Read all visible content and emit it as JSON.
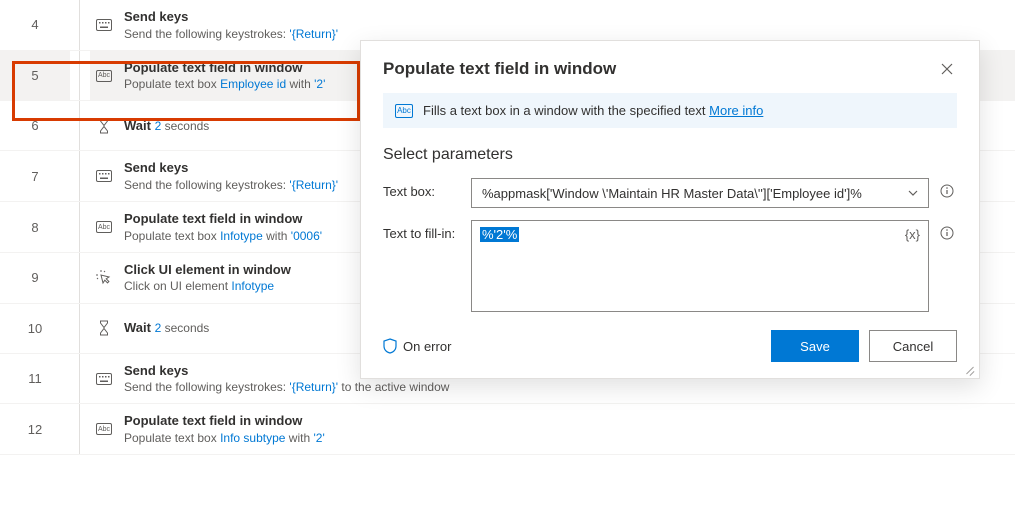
{
  "steps": [
    {
      "num": "4",
      "icon": "keyboard",
      "title": "Send keys",
      "desc_pre": "Send the following keystrokes: ",
      "tok1": "'{Return}'",
      "desc_mid": "",
      "tok2": "",
      "desc_post": ""
    },
    {
      "num": "5",
      "icon": "abc",
      "title": "Populate text field in window",
      "desc_pre": "Populate text box ",
      "tok1": "Employee id",
      "desc_mid": " with ",
      "tok2": "'2'",
      "desc_post": ""
    },
    {
      "num": "6",
      "icon": "hourglass",
      "title": "Wait",
      "desc_pre": "",
      "tok1": "2",
      "desc_mid": " seconds",
      "tok2": "",
      "desc_post": "",
      "inline": true
    },
    {
      "num": "7",
      "icon": "keyboard",
      "title": "Send keys",
      "desc_pre": "Send the following keystrokes: ",
      "tok1": "'{Return}'",
      "desc_mid": "",
      "tok2": "",
      "desc_post": ""
    },
    {
      "num": "8",
      "icon": "abc",
      "title": "Populate text field in window",
      "desc_pre": "Populate text box ",
      "tok1": "Infotype",
      "desc_mid": " with ",
      "tok2": "'0006'",
      "desc_post": ""
    },
    {
      "num": "9",
      "icon": "click",
      "title": "Click UI element in window",
      "desc_pre": "Click on UI element ",
      "tok1": "Infotype",
      "desc_mid": "",
      "tok2": "",
      "desc_post": ""
    },
    {
      "num": "10",
      "icon": "hourglass",
      "title": "Wait",
      "desc_pre": "",
      "tok1": "2",
      "desc_mid": " seconds",
      "tok2": "",
      "desc_post": "",
      "inline": true
    },
    {
      "num": "11",
      "icon": "keyboard",
      "title": "Send keys",
      "desc_pre": "Send the following keystrokes: ",
      "tok1": "'{Return}'",
      "desc_mid": " to the active window",
      "tok2": "",
      "desc_post": ""
    },
    {
      "num": "12",
      "icon": "abc",
      "title": "Populate text field in window",
      "desc_pre": "Populate text box ",
      "tok1": "Info subtype",
      "desc_mid": " with ",
      "tok2": "'2'",
      "desc_post": ""
    }
  ],
  "dialog": {
    "title": "Populate text field in window",
    "banner_text": "Fills a text box in a window with the specified text ",
    "more_info": "More info",
    "section": "Select parameters",
    "param_textbox_label": "Text box:",
    "param_textbox_value": "%appmask['Window \\'Maintain HR Master Data\\'']['Employee id']%",
    "param_fill_label": "Text to fill-in:",
    "param_fill_value": "%'2'%",
    "fx_label": "{x}",
    "on_error": "On error",
    "save": "Save",
    "cancel": "Cancel"
  },
  "icons": {
    "abc": "Abc"
  }
}
